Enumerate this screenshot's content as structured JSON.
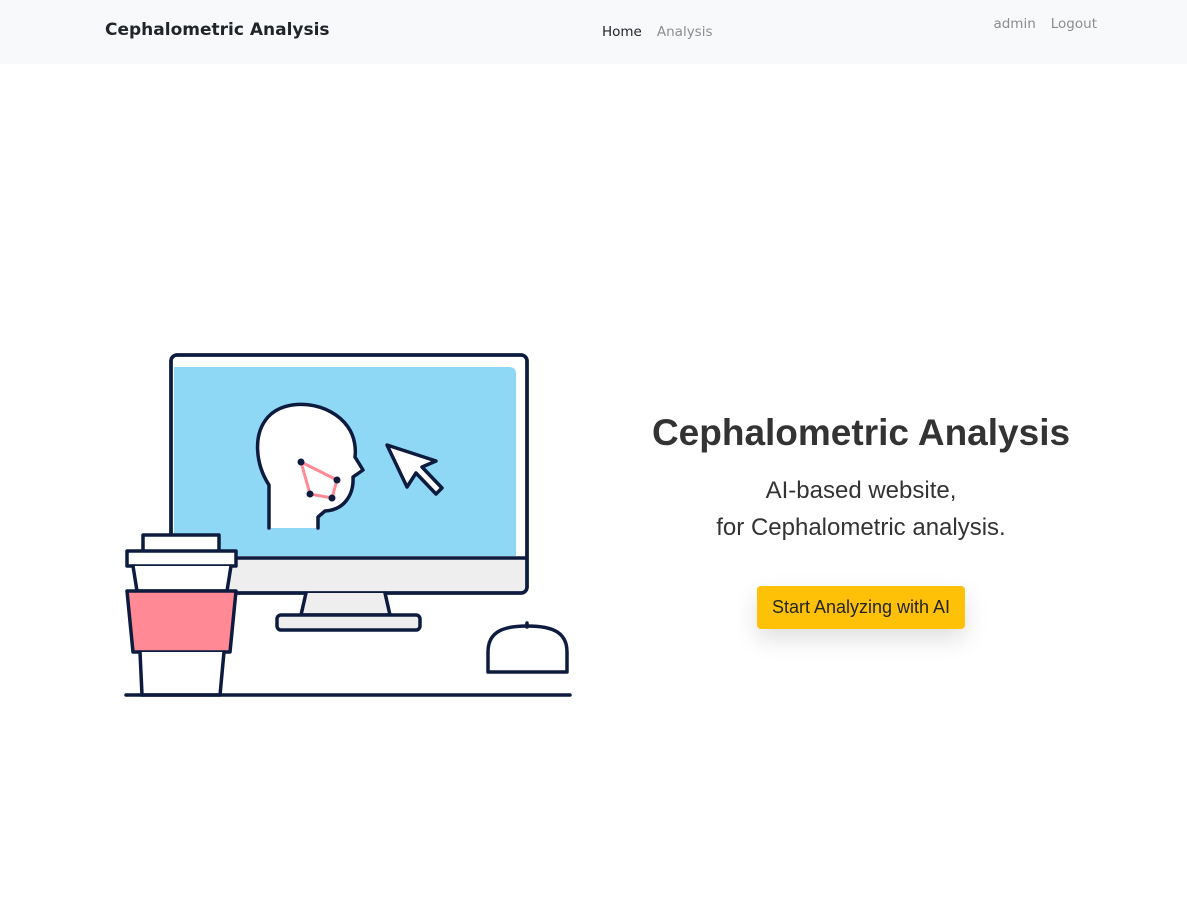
{
  "navbar": {
    "brand": "Cephalometric Analysis",
    "links": [
      {
        "label": "Home",
        "active": true
      },
      {
        "label": "Analysis",
        "active": false
      }
    ],
    "user": "admin",
    "logout": "Logout"
  },
  "hero": {
    "title": "Cephalometric Analysis",
    "subtitle_line1": "AI-based website,",
    "subtitle_line2": "for Cephalometric analysis.",
    "cta_label": "Start Analyzing with AI"
  },
  "colors": {
    "navbar_bg": "#f8f9fa",
    "accent": "#ffc107",
    "screen": "#8fd8f5",
    "cup_sleeve": "#ff8a95",
    "outline": "#0d1b3e"
  },
  "icons": {
    "illustration": "computer-with-face-landmarks-illustration",
    "cursor": "mouse-pointer-icon"
  }
}
